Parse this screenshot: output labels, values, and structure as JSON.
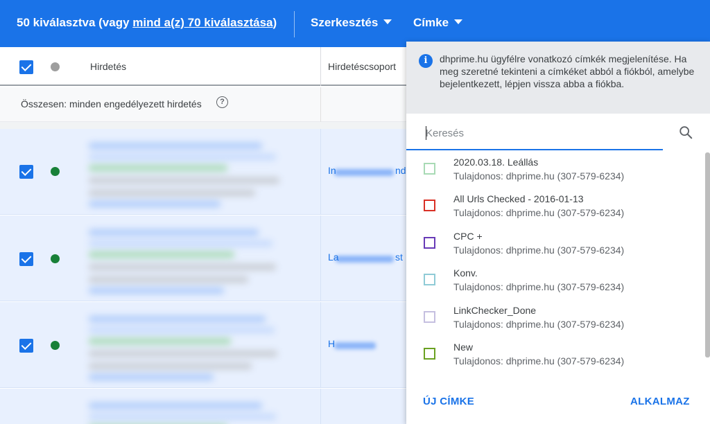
{
  "topbar": {
    "selection_prefix": "50 kiválasztva (vagy ",
    "selection_link": "mind a(z) 70 kiválasztása",
    "selection_suffix": ")",
    "edit_label": "Szerkesztés",
    "label_menu": "Címke",
    "background_color": "#1a73e8"
  },
  "table": {
    "headers": {
      "ad": "Hirdetés",
      "ad_group": "Hirdetéscsoport"
    },
    "total_row": {
      "text": "Összesen: minden engedélyezett hirdetés",
      "help_icon": "help-circle-icon"
    },
    "rows": [
      {
        "checked": true,
        "status_color": "#188038",
        "ad_group_visible_start": "In",
        "ad_group_visible_end": "nd"
      },
      {
        "checked": true,
        "status_color": "#188038",
        "ad_group_visible_start": "La",
        "ad_group_visible_end": "st"
      },
      {
        "checked": true,
        "status_color": "#188038",
        "ad_group_visible_start": "H",
        "ad_group_visible_end": ""
      }
    ]
  },
  "label_panel": {
    "info_icon": "info-icon",
    "info_text": "dhprime.hu ügyfélre vonatkozó címkék megjelenítése. Ha meg szeretné tekinteni a címkéket abból a fiókból, amelybe bejelentkezett, lépjen vissza abba a fiókba.",
    "search_placeholder": "Keresés",
    "search_icon": "search-icon",
    "labels": [
      {
        "name": "2020.03.18. Leállás",
        "owner": "Tulajdonos: dhprime.hu (307-579-6234)",
        "color": "#a8dab5"
      },
      {
        "name": "All Urls Checked - 2016-01-13",
        "owner": "Tulajdonos: dhprime.hu (307-579-6234)",
        "color": "#d93025"
      },
      {
        "name": "CPC +",
        "owner": "Tulajdonos: dhprime.hu (307-579-6234)",
        "color": "#673ab7"
      },
      {
        "name": "Konv.",
        "owner": "Tulajdonos: dhprime.hu (307-579-6234)",
        "color": "#8fcbd6"
      },
      {
        "name": "LinkChecker_Done",
        "owner": "Tulajdonos: dhprime.hu (307-579-6234)",
        "color": "#c5bfe0"
      },
      {
        "name": "New",
        "owner": "Tulajdonos: dhprime.hu (307-579-6234)",
        "color": "#6aa121"
      }
    ],
    "new_label_button": "ÚJ CÍMKE",
    "apply_button": "ALKALMAZ"
  }
}
